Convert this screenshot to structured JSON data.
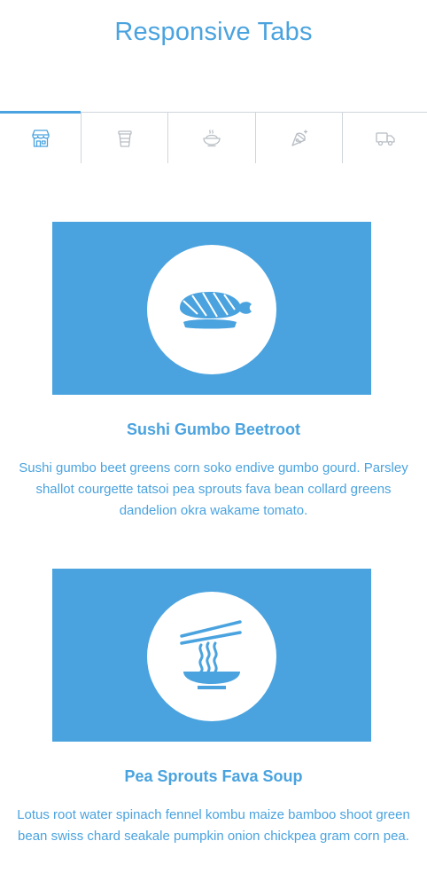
{
  "page": {
    "title": "Responsive Tabs"
  },
  "colors": {
    "accent": "#4aa3df",
    "tab_inactive": "#b8bec4",
    "divider": "#d0d5da",
    "background": "#ffffff"
  },
  "tabs": [
    {
      "icon": "store-icon",
      "active": true
    },
    {
      "icon": "cup-icon",
      "active": false
    },
    {
      "icon": "noodle-bowl-icon",
      "active": false
    },
    {
      "icon": "pizza-slice-icon",
      "active": false
    },
    {
      "icon": "delivery-truck-icon",
      "active": false
    }
  ],
  "items": [
    {
      "icon": "sushi-icon",
      "title": "Sushi Gumbo Beetroot",
      "text": "Sushi gumbo beet greens corn soko endive gumbo gourd. Parsley shallot courgette tatsoi pea sprouts fava bean collard greens dandelion okra wakame tomato."
    },
    {
      "icon": "noodle-bowl-icon",
      "title": "Pea Sprouts Fava Soup",
      "text": "Lotus root water spinach fennel kombu maize bamboo shoot green bean swiss chard seakale pumpkin onion chickpea gram corn pea."
    }
  ]
}
